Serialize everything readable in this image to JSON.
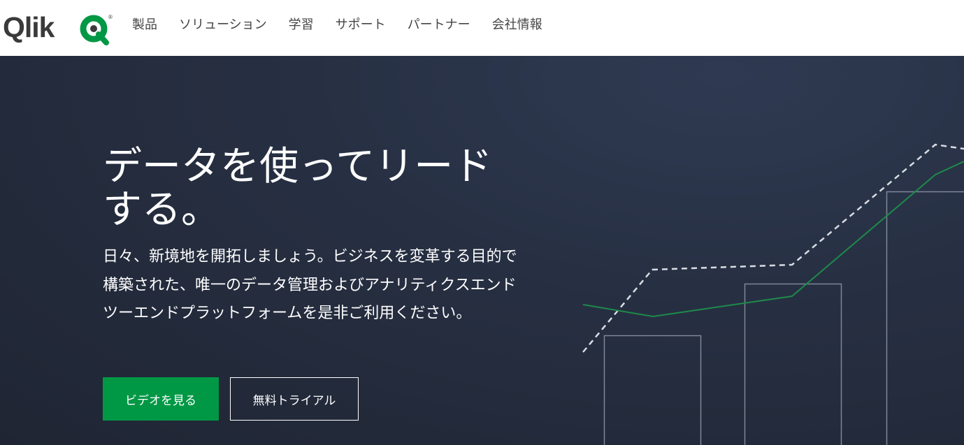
{
  "brand": {
    "name": "Qlik",
    "registered_mark": "®",
    "accent_color": "#009845"
  },
  "nav": {
    "items": [
      {
        "label": "製品"
      },
      {
        "label": "ソリューション"
      },
      {
        "label": "学習"
      },
      {
        "label": "サポート"
      },
      {
        "label": "パートナー"
      },
      {
        "label": "会社情報"
      }
    ]
  },
  "hero": {
    "title": "データを使ってリードする。",
    "description": "日々、新境地を開拓しましょう。ビジネスを変革する目的で構築された、唯一のデータ管理およびアナリティクスエンドツーエンドプラットフォームを是非ご利用ください。",
    "primary_button": "ビデオを見る",
    "secondary_button": "無料トライアル",
    "background_color": "#273043",
    "graphic_line_color": "#1e8a4a",
    "graphic_dash_color": "#d9dde3"
  }
}
